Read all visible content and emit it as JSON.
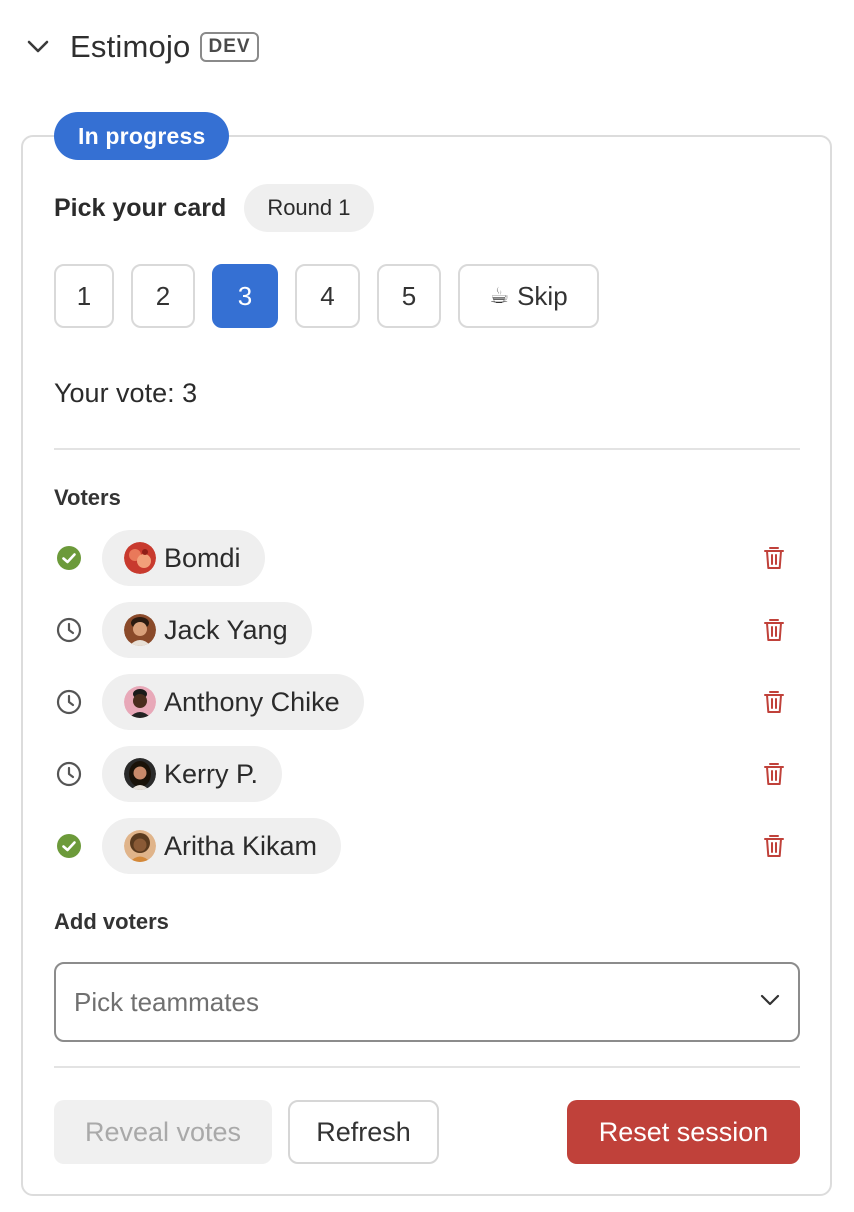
{
  "app": {
    "title": "Estimojo",
    "env_badge": "DEV"
  },
  "session": {
    "status": "In progress",
    "pick_title": "Pick your card",
    "round_label": "Round 1",
    "cards": [
      {
        "label": "1",
        "selected": false
      },
      {
        "label": "2",
        "selected": false
      },
      {
        "label": "3",
        "selected": true
      },
      {
        "label": "4",
        "selected": false
      },
      {
        "label": "5",
        "selected": false
      },
      {
        "label": "Skip",
        "icon": "coffee-icon",
        "glyph": "☕",
        "selected": false
      }
    ],
    "your_vote": "Your vote: 3"
  },
  "voters": {
    "label": "Voters",
    "items": [
      {
        "name": "Bomdi",
        "status": "voted",
        "status_icon": "check-circle-icon"
      },
      {
        "name": "Jack Yang",
        "status": "pending",
        "status_icon": "clock-icon"
      },
      {
        "name": "Anthony Chike",
        "status": "pending",
        "status_icon": "clock-icon"
      },
      {
        "name": "Kerry P.",
        "status": "pending",
        "status_icon": "clock-icon"
      },
      {
        "name": "Aritha Kikam",
        "status": "voted",
        "status_icon": "check-circle-icon"
      }
    ]
  },
  "add_voters": {
    "label": "Add voters",
    "placeholder": "Pick teammates"
  },
  "actions": {
    "reveal_label": "Reveal votes",
    "refresh_label": "Refresh",
    "reset_label": "Reset session"
  },
  "colors": {
    "accent": "#3570d3",
    "voted": "#6c9a3a",
    "pending": "#555555",
    "danger": "#c0413a"
  }
}
